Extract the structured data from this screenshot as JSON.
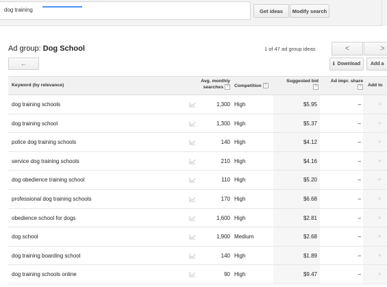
{
  "search": {
    "value": "dog training",
    "get_ideas": "Get ideas",
    "modify_search": "Modify search"
  },
  "ad_group": {
    "label": "Ad group: ",
    "name": "Dog School",
    "pager_text": "1 of 47 ad group ideas",
    "prev_symbol": "<",
    "next_symbol": ">",
    "back_symbol": "←",
    "download_label": "Download",
    "download_icon": "⭳",
    "add_label": "Add a"
  },
  "columns": {
    "keyword": "Keyword (by relevance)",
    "searches_line1": "Avg. monthly",
    "searches_line2": "searches",
    "competition": "Competition",
    "bid": "Suggested bid",
    "impr": "Ad impr. share",
    "add": "Add to",
    "help": "?"
  },
  "rows": [
    {
      "keyword": "dog training schools",
      "searches": "1,300",
      "competition": "High",
      "bid": "$5.95",
      "impr": "–"
    },
    {
      "keyword": "dog training school",
      "searches": "1,300",
      "competition": "High",
      "bid": "$5.37",
      "impr": "–"
    },
    {
      "keyword": "police dog training schools",
      "searches": "140",
      "competition": "High",
      "bid": "$4.12",
      "impr": "–"
    },
    {
      "keyword": "service dog training schools",
      "searches": "210",
      "competition": "High",
      "bid": "$4.16",
      "impr": "–"
    },
    {
      "keyword": "dog obedience training school",
      "searches": "110",
      "competition": "High",
      "bid": "$5.20",
      "impr": "–"
    },
    {
      "keyword": "professional dog training schools",
      "searches": "170",
      "competition": "High",
      "bid": "$6.68",
      "impr": "–"
    },
    {
      "keyword": "obedience school for dogs",
      "searches": "1,600",
      "competition": "High",
      "bid": "$2.81",
      "impr": "–"
    },
    {
      "keyword": "dog school",
      "searches": "1,900",
      "competition": "Medium",
      "bid": "$2.68",
      "impr": "–"
    },
    {
      "keyword": "dog training boarding school",
      "searches": "140",
      "competition": "High",
      "bid": "$1.89",
      "impr": "–"
    },
    {
      "keyword": "dog training schools online",
      "searches": "90",
      "competition": "High",
      "bid": "$9.47",
      "impr": "–"
    }
  ],
  "add_arrow": "»",
  "colors": {
    "accent": "#4d90fe",
    "header_bg": "#f1f1f1"
  }
}
